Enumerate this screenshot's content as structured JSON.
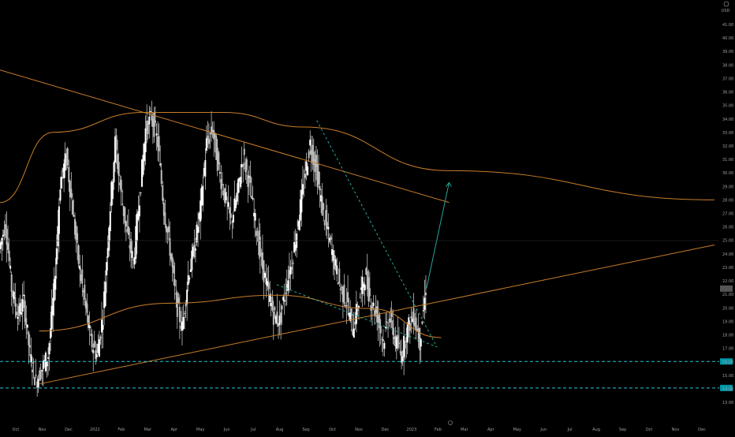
{
  "settings_icon": "gear-icon",
  "scale_label": "USD",
  "price_ticks": [
    "41.00",
    "40.00",
    "39.00",
    "38.00",
    "37.00",
    "36.00",
    "35.00",
    "34.00",
    "33.00",
    "32.00",
    "31.00",
    "30.00",
    "29.00",
    "28.00",
    "27.00",
    "26.00",
    "25.00",
    "24.00",
    "23.00",
    "22.00",
    "21.00",
    "20.00",
    "19.00",
    "18.00",
    "17.00",
    "16.00",
    "15.00",
    "14.00",
    "13.00"
  ],
  "time_ticks": [
    "Oct",
    "Nov",
    "Dec",
    "2022",
    "Feb",
    "Mar",
    "Apr",
    "May",
    "Jun",
    "Jul",
    "Aug",
    "Sep",
    "Oct",
    "Nov",
    "Dec",
    "2023",
    "Feb",
    "Mar",
    "Apr",
    "May",
    "Jun",
    "Jul",
    "Aug",
    "Sep",
    "Oct",
    "Nov",
    "Dec"
  ],
  "colors": {
    "background": "#000000",
    "candles": "#ffffff",
    "arc_lines": "#c77d29",
    "trend_dashed": "#26a69a",
    "horizontal_levels": "#26c6da",
    "arrow": "#26a69a"
  },
  "chart_data": {
    "type": "candlestick",
    "title": "",
    "xlabel": "",
    "ylabel": "",
    "ylim": [
      13.3,
      42.0
    ],
    "x_range": [
      "2021-10-01",
      "2023-12-31"
    ],
    "grid": false,
    "current_price": 22.0,
    "horizontal_levels": [
      16.5,
      14.5
    ],
    "close_series": [
      [
        "2021-10-01",
        25
      ],
      [
        "2021-10-08",
        27
      ],
      [
        "2021-10-15",
        22
      ],
      [
        "2021-10-22",
        20
      ],
      [
        "2021-10-29",
        21
      ],
      [
        "2021-11-05",
        17
      ],
      [
        "2021-11-12",
        15
      ],
      [
        "2021-11-19",
        16
      ],
      [
        "2021-11-26",
        17
      ],
      [
        "2021-12-03",
        22
      ],
      [
        "2021-12-10",
        30
      ],
      [
        "2021-12-17",
        32
      ],
      [
        "2021-12-24",
        28
      ],
      [
        "2021-12-31",
        24
      ],
      [
        "2022-01-07",
        21
      ],
      [
        "2022-01-14",
        18
      ],
      [
        "2022-01-21",
        17
      ],
      [
        "2022-01-28",
        20
      ],
      [
        "2022-02-04",
        27
      ],
      [
        "2022-02-11",
        33
      ],
      [
        "2022-02-18",
        29
      ],
      [
        "2022-02-25",
        26
      ],
      [
        "2022-03-04",
        24
      ],
      [
        "2022-03-11",
        29
      ],
      [
        "2022-03-18",
        34
      ],
      [
        "2022-03-25",
        35
      ],
      [
        "2022-04-01",
        33
      ],
      [
        "2022-04-08",
        28
      ],
      [
        "2022-04-15",
        25
      ],
      [
        "2022-04-22",
        21
      ],
      [
        "2022-04-29",
        19
      ],
      [
        "2022-05-06",
        23
      ],
      [
        "2022-05-13",
        25
      ],
      [
        "2022-05-20",
        28
      ],
      [
        "2022-05-27",
        33
      ],
      [
        "2022-06-03",
        34
      ],
      [
        "2022-06-10",
        31
      ],
      [
        "2022-06-17",
        29
      ],
      [
        "2022-06-24",
        27
      ],
      [
        "2022-07-01",
        29
      ],
      [
        "2022-07-08",
        32
      ],
      [
        "2022-07-15",
        30
      ],
      [
        "2022-07-22",
        27
      ],
      [
        "2022-07-29",
        24
      ],
      [
        "2022-08-05",
        22
      ],
      [
        "2022-08-12",
        20
      ],
      [
        "2022-08-19",
        19.5
      ],
      [
        "2022-08-26",
        22
      ],
      [
        "2022-09-02",
        24
      ],
      [
        "2022-09-09",
        27
      ],
      [
        "2022-09-16",
        30
      ],
      [
        "2022-09-23",
        33
      ],
      [
        "2022-09-30",
        31
      ],
      [
        "2022-10-07",
        28
      ],
      [
        "2022-10-14",
        26
      ],
      [
        "2022-10-21",
        24
      ],
      [
        "2022-10-28",
        22
      ],
      [
        "2022-11-04",
        21
      ],
      [
        "2022-11-11",
        19
      ],
      [
        "2022-11-18",
        21
      ],
      [
        "2022-11-25",
        23
      ],
      [
        "2022-12-02",
        21
      ],
      [
        "2022-12-09",
        20
      ],
      [
        "2022-12-16",
        18
      ],
      [
        "2022-12-23",
        20
      ],
      [
        "2022-12-30",
        18
      ],
      [
        "2023-01-06",
        17
      ],
      [
        "2023-01-13",
        19
      ],
      [
        "2023-01-20",
        20
      ],
      [
        "2023-01-27",
        18
      ],
      [
        "2023-02-03",
        22
      ]
    ],
    "drawings": [
      {
        "type": "arc",
        "name": "upper arc",
        "y_values": [
          28.5,
          33.8,
          35.3,
          35.3,
          34.2,
          30.9,
          28.7
        ]
      },
      {
        "type": "arc",
        "name": "lower arc",
        "y_values": [
          18.8,
          20.9,
          21.5,
          20.5,
          18.3
        ]
      },
      {
        "type": "trendline",
        "name": "descending resistance",
        "from": [
          "2021-10-01",
          38.5
        ],
        "to": [
          "2023-03-01",
          28.5
        ]
      },
      {
        "type": "trendline",
        "name": "rising support",
        "from": [
          "2021-11-15",
          14.8
        ],
        "to": [
          "2023-12-31",
          25.3
        ]
      },
      {
        "type": "trendline",
        "name": "dashed falling wedge upper",
        "from": [
          "2022-09-30",
          34.7
        ],
        "to": [
          "2023-02-15",
          17.6
        ]
      },
      {
        "type": "trendline",
        "name": "dashed falling wedge lower",
        "from": [
          "2022-08-15",
          22.3
        ],
        "to": [
          "2023-02-15",
          17.6
        ]
      },
      {
        "type": "arrow",
        "name": "projection",
        "from": [
          "2023-02-03",
          22.0
        ],
        "to": [
          "2023-03-01",
          30.0
        ]
      }
    ]
  }
}
